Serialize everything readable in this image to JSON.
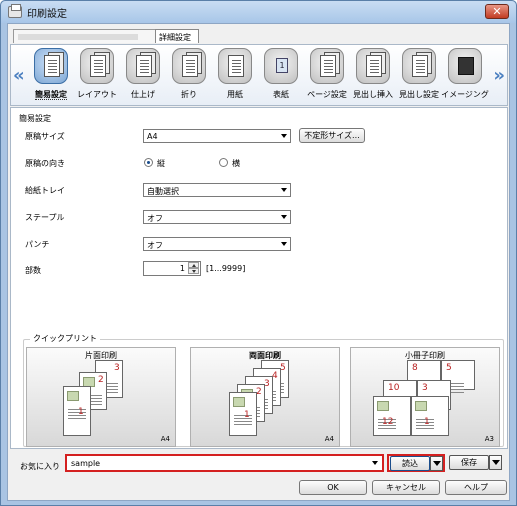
{
  "window": {
    "title": "印刷設定",
    "close_label": "✕"
  },
  "tabs": {
    "detail": "詳細設定"
  },
  "nav": {
    "left": "«",
    "right": "»"
  },
  "toolbar": {
    "items": [
      {
        "label": "簡易設定",
        "icon": "quick-setup-icon"
      },
      {
        "label": "レイアウト",
        "icon": "layout-icon"
      },
      {
        "label": "仕上げ",
        "icon": "finishing-icon"
      },
      {
        "label": "折り",
        "icon": "fold-icon"
      },
      {
        "label": "用紙",
        "icon": "paper-icon"
      },
      {
        "label": "表紙",
        "icon": "cover-icon",
        "badge": "1"
      },
      {
        "label": "ページ設定",
        "icon": "page-setting-icon"
      },
      {
        "label": "見出し挿入",
        "icon": "tab-insert-icon"
      },
      {
        "label": "見出し設定",
        "icon": "tab-setting-icon"
      },
      {
        "label": "イメージング",
        "icon": "imaging-icon"
      }
    ]
  },
  "panel": {
    "section_title": "簡易設定",
    "original_size": {
      "label": "原稿サイズ",
      "value": "A4",
      "custom_button": "不定形サイズ..."
    },
    "orientation": {
      "label": "原稿の向き",
      "portrait": "縦",
      "landscape": "横",
      "selected": "縦"
    },
    "tray": {
      "label": "給紙トレイ",
      "value": "自動選択"
    },
    "staple": {
      "label": "ステープル",
      "value": "オフ"
    },
    "punch": {
      "label": "パンチ",
      "value": "オフ"
    },
    "copies": {
      "label": "部数",
      "value": "1",
      "range": "[1...9999]"
    }
  },
  "quick_print": {
    "title": "クイックプリント",
    "cards": [
      {
        "label": "片面印刷",
        "size": "A4",
        "pages": [
          "3",
          "2",
          "1"
        ]
      },
      {
        "label": "両面印刷",
        "size": "A4",
        "pages": [
          "5",
          "4",
          "3",
          "2",
          "1"
        ]
      },
      {
        "label": "小冊子印刷",
        "size": "A3",
        "pages": [
          "8",
          "5",
          "10",
          "3",
          "12",
          "1"
        ]
      }
    ]
  },
  "favorites": {
    "label": "お気に入り",
    "value": "sample",
    "load_button": "読込",
    "save_button": "保存"
  },
  "footer": {
    "ok": "OK",
    "cancel": "キャンセル",
    "help": "ヘルプ"
  },
  "colors": {
    "highlight": "#d42020",
    "accent": "#4a7fc0"
  }
}
